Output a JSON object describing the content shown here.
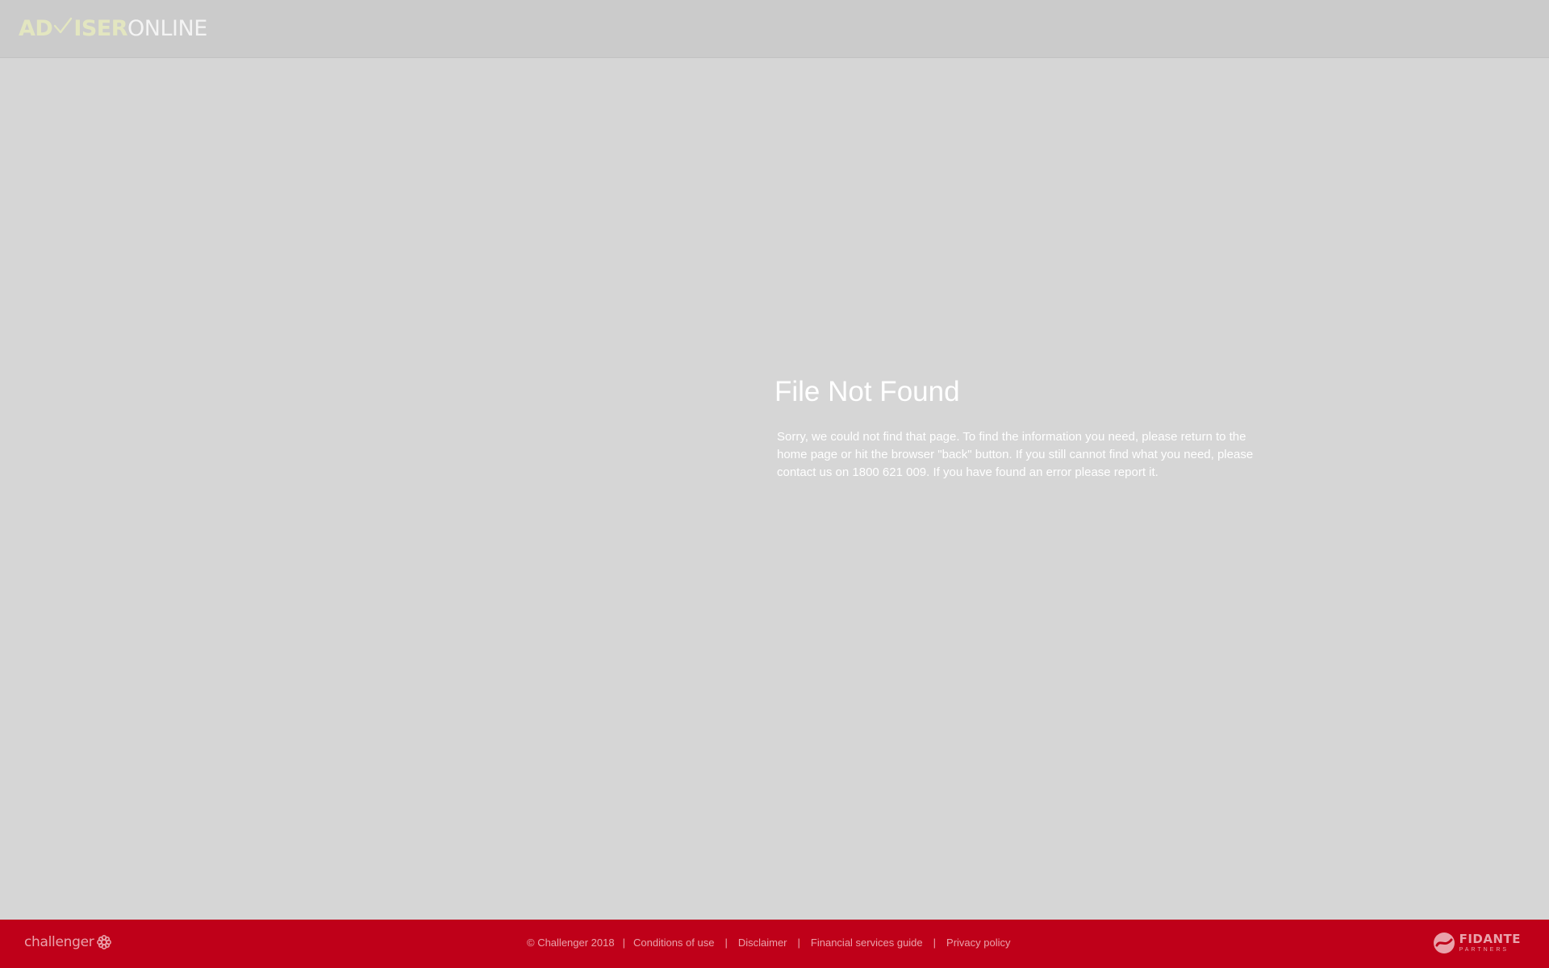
{
  "header": {
    "logo": {
      "part1": "AD",
      "part2": "ISER",
      "part3": "ONLINE",
      "check_icon": "checkmark-icon"
    }
  },
  "main": {
    "title": "File Not Found",
    "message": "Sorry, we could not find that page. To find the information you need, please return to the home page or hit the browser \"back\" button. If you still cannot find what you need, please contact us on 1800 621 009. If you have found an error please report it."
  },
  "footer": {
    "challenger_logo": "challenger",
    "copyright": "© Challenger 2018",
    "separator": "|",
    "links": {
      "conditions": "Conditions of use",
      "disclaimer": "Disclaimer",
      "fsg": "Financial services guide",
      "privacy": "Privacy policy"
    },
    "fidante_logo": {
      "name": "FIDANTE",
      "sub": "PARTNERS"
    }
  },
  "colors": {
    "header_bg": "#cbcbcb",
    "page_bg": "#d6d6d6",
    "footer_bg": "#bf0019",
    "logo_accent": "#e3e6c0",
    "footer_text": "#e9a2ab"
  }
}
